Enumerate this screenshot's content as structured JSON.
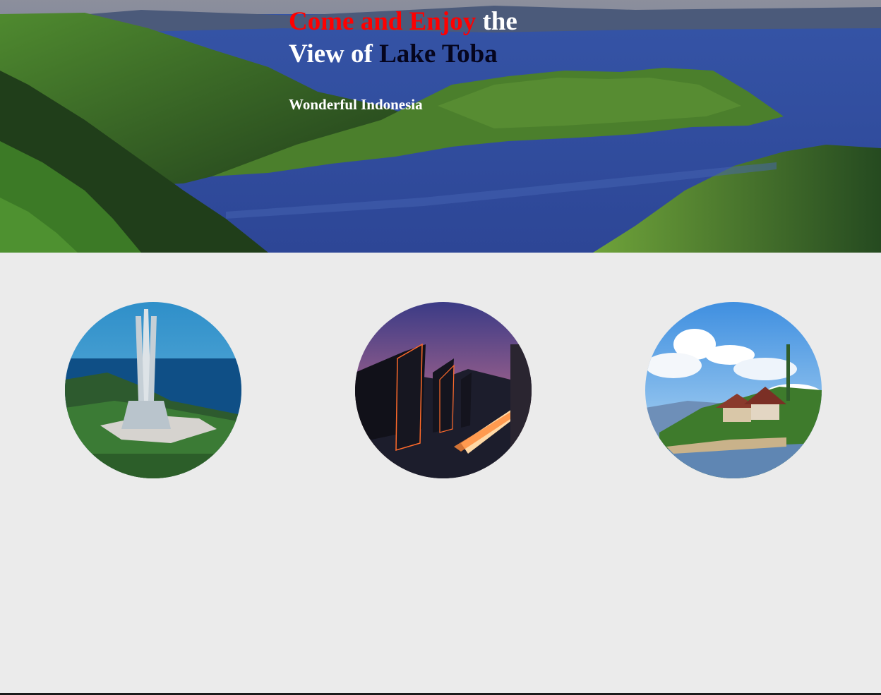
{
  "hero": {
    "headline_part1": "Come and Enjoy",
    "headline_part2": " the",
    "headline_part3": "View of ",
    "headline_part4": "Lake Toba",
    "tagline": "Wonderful Indonesia"
  },
  "colors": {
    "headline_accent": "#ff0000",
    "headline_dark": "#05051e",
    "headline_light": "#ffffff",
    "section_background": "#ebebeb"
  },
  "gallery": {
    "items": [
      {
        "image": "tower-monument-by-the-lake"
      },
      {
        "image": "night-street-with-traditional-roofs"
      },
      {
        "image": "lakeside-village-with-clouds"
      }
    ]
  }
}
